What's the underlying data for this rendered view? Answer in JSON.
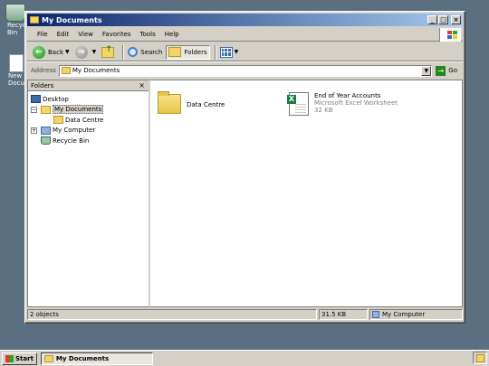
{
  "desktop": {
    "icons": [
      {
        "label": "Recycle Bin"
      },
      {
        "label": "New Document"
      }
    ]
  },
  "window": {
    "title": "My Documents",
    "controls": {
      "minimize": "_",
      "maximize": "□",
      "close": "×"
    }
  },
  "menubar": {
    "items": [
      "File",
      "Edit",
      "View",
      "Favorites",
      "Tools",
      "Help"
    ]
  },
  "toolbar": {
    "back_label": "Back",
    "search_label": "Search",
    "folders_label": "Folders"
  },
  "address": {
    "label": "Address",
    "value": "My Documents",
    "go_label": "Go"
  },
  "folders_pane": {
    "title": "Folders",
    "close": "×",
    "tree": [
      {
        "label": "Desktop",
        "level": 0
      },
      {
        "label": "My Documents",
        "level": 1,
        "expander": "−",
        "selected": true
      },
      {
        "label": "Data Centre",
        "level": 2
      },
      {
        "label": "My Computer",
        "level": 1,
        "expander": "+"
      },
      {
        "label": "Recycle Bin",
        "level": 1
      }
    ]
  },
  "files": [
    {
      "name": "Data Centre",
      "type": "folder"
    },
    {
      "name": "End of Year Accounts",
      "kind": "Microsoft Excel Worksheet",
      "size": "32 KB",
      "type": "excel"
    }
  ],
  "statusbar": {
    "objects": "2 objects",
    "size": "31.5 KB",
    "zone": "My Computer"
  },
  "taskbar": {
    "start_label": "Start",
    "task_label": "My Documents"
  }
}
